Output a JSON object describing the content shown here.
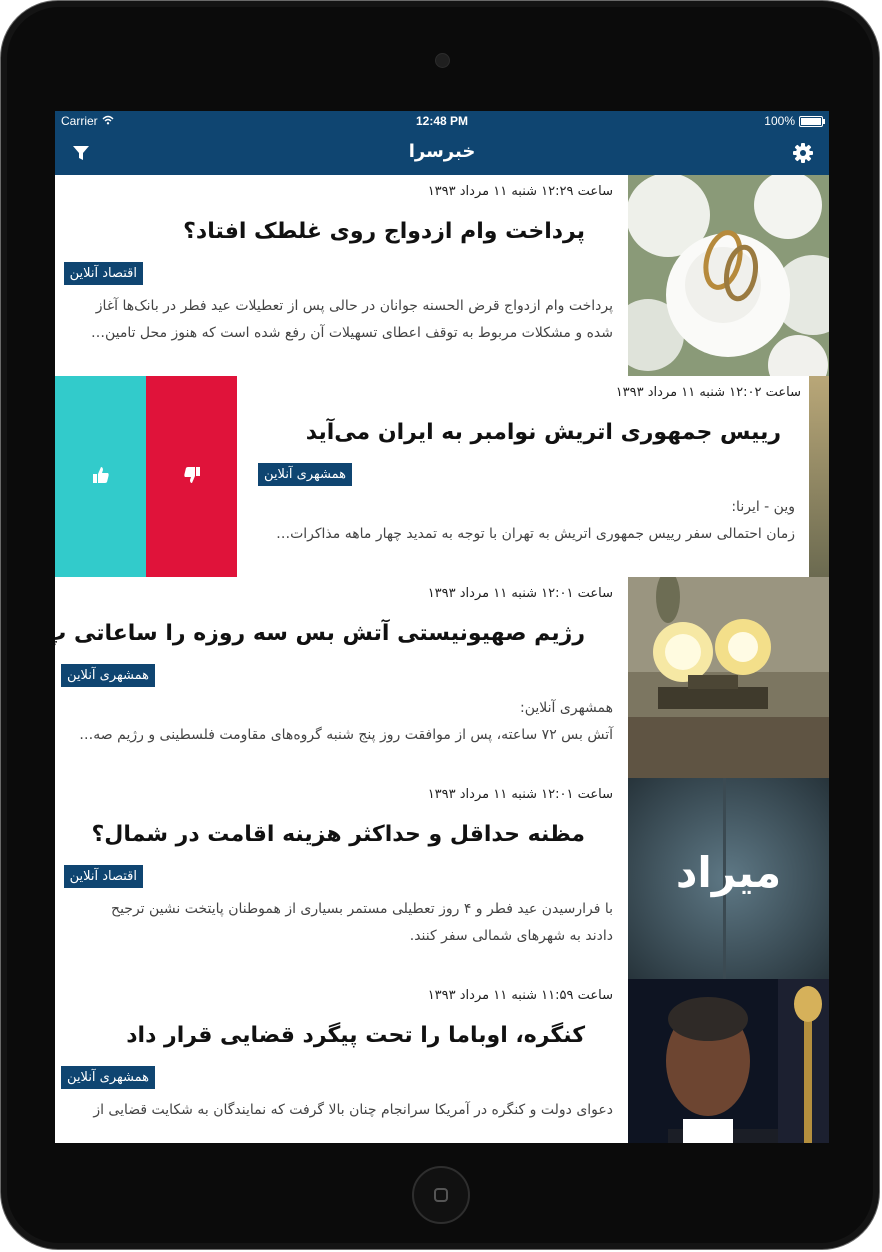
{
  "statusbar": {
    "carrier": "Carrier",
    "time": "12:48 PM",
    "battery": "100%"
  },
  "navbar": {
    "title": "خبرسرا",
    "left_icon": "filter-icon",
    "right_icon": "gear-icon"
  },
  "swipe_actions": {
    "like_icon": "thumbs-up-icon",
    "dislike_icon": "thumbs-down-icon",
    "like_color": "#32cbcb",
    "dislike_color": "#e0133a"
  },
  "colors": {
    "brand": "#0f4571"
  },
  "news": [
    {
      "meta": "ساعت ۱۲:۲۹ شنبه ۱۱ مرداد ۱۳۹۳",
      "title": "پرداخت وام ازدواج روی غلطک افتاد؟",
      "source": "اقتصاد آنلاین",
      "summary_line1": "پرداخت وام ازدواج قرض الحسنه جوانان در حالی پس از تعطیلات عید فطر در بانک‌ها آغاز",
      "summary_line2": "شده و مشکلات مربوط به توقف اعطای تسهیلات آن رفع شده است که هنوز محل تامین…",
      "thumb": "wedding-rings-image"
    },
    {
      "meta": "ساعت ۱۲:۰۲ شنبه ۱۱ مرداد ۱۳۹۳",
      "title": "رییس جمهوری اتریش نوامبر به ایران می‌آید",
      "source": "همشهری آنلاین",
      "summary_line1": "وین - ایرنا:",
      "summary_line2": "زمان احتمالی سفر رییس جمهوری اتریش به تهران با توجه به تمدید چهار ماهه مذاکرات…",
      "thumb": "news-image"
    },
    {
      "meta": "ساعت ۱۲:۰۱ شنبه ۱۱ مرداد ۱۳۹۳",
      "title": "رژیم صهیونیستی آتش بس سه روزه را ساعاتی پ…",
      "source": "همشهری آنلاین",
      "summary_line1": "همشهری آنلاین:",
      "summary_line2": "آتش بس ۷۲ ساعته، پس از موافقت روز پنج شنبه گروه‌های مقاومت فلسطینی و رژیم صه…",
      "thumb": "artillery-fire-image"
    },
    {
      "meta": "ساعت ۱۲:۰۱ شنبه ۱۱ مرداد ۱۳۹۳",
      "title": "مظنه حداقل و حداکثر هزینه اقامت در شمال؟",
      "source": "اقتصاد آنلاین",
      "summary_line1": "با فرارسیدن عید فطر و ۴ روز تعطیلی مستمر بسیاری از هموطنان پایتخت نشین ترجیح",
      "summary_line2": "دادند به شهرهای شمالی سفر کنند.",
      "thumb_text": "میراد",
      "thumb": "mirad-logo-image"
    },
    {
      "meta": "ساعت ۱۱:۵۹ شنبه ۱۱ مرداد ۱۳۹۳",
      "title": "کنگره، اوباما را تحت پیگرد قضایی قرار داد",
      "source": "همشهری آنلاین",
      "summary_line1": "دعوای دولت و کنگره در آمریکا سرانجام چنان بالا گرفت که نمایندگان به شکایت قضایی از",
      "summary_line2": "…",
      "thumb": "portrait-image"
    }
  ]
}
